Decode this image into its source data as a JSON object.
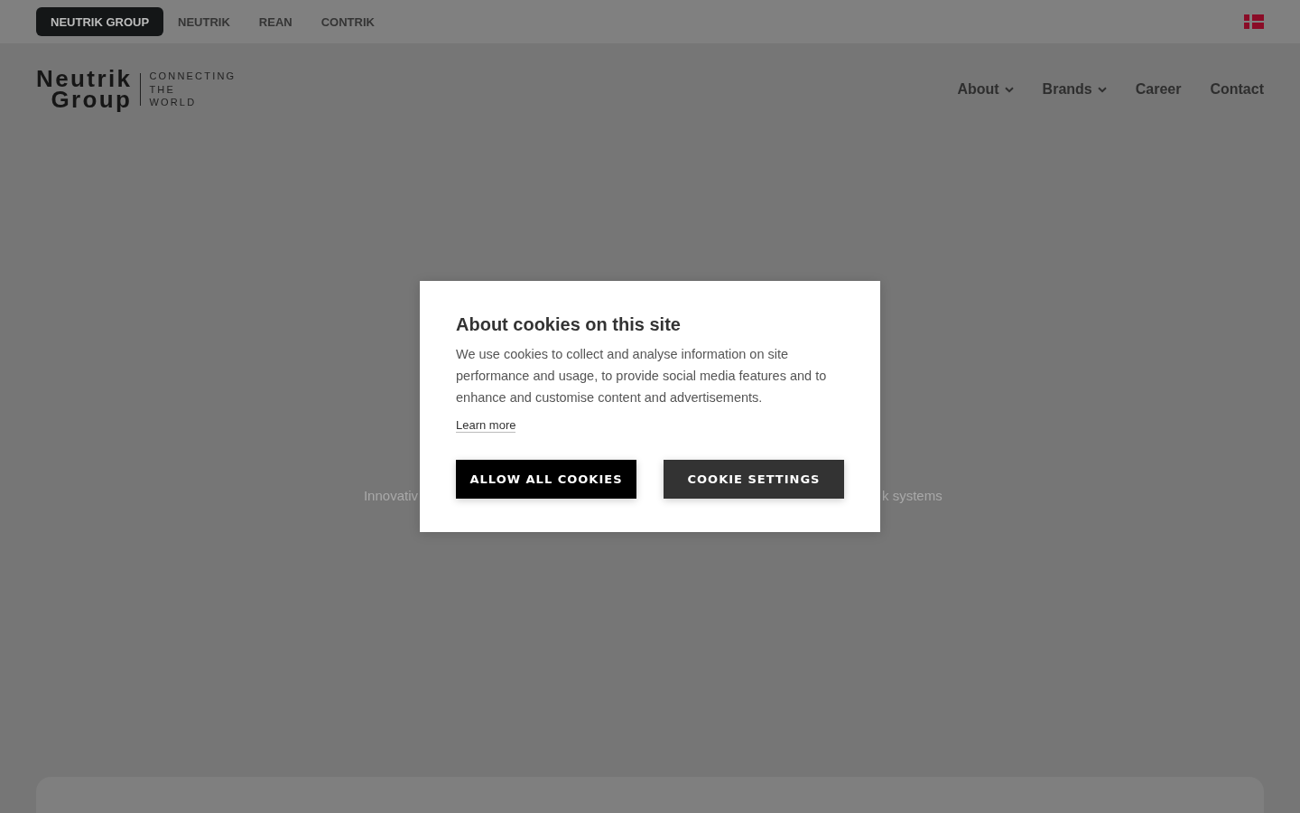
{
  "brand_tabs": [
    {
      "label": "NEUTRIK GROUP",
      "selected": true
    },
    {
      "label": "NEUTRIK",
      "selected": false
    },
    {
      "label": "REAN",
      "selected": false
    },
    {
      "label": "CONTRIK",
      "selected": false
    }
  ],
  "header": {
    "logo": {
      "wordmark_lines": [
        "Neutrik",
        "Group"
      ],
      "tagline_lines": [
        "CONNECTING",
        "THE",
        "WORLD"
      ]
    },
    "nav": [
      {
        "label": "About",
        "dropdown": true
      },
      {
        "label": "Brands",
        "dropdown": true
      },
      {
        "label": "Career",
        "dropdown": false
      },
      {
        "label": "Contact",
        "dropdown": false
      }
    ]
  },
  "hero": {
    "subtitle_fragments": [
      "Innovativ",
      "k systems"
    ]
  },
  "cookie_dialog": {
    "title": "About cookies on this site",
    "text": "We use cookies to collect and analyse information on site performance and usage, to provide social media features and to enhance and customise content and advertisements.",
    "link": "Learn more",
    "buttons": [
      {
        "label": "ALLOW ALL COOKIES",
        "kind": "primary"
      },
      {
        "label": "COOKIE SETTINGS",
        "kind": "secondary"
      }
    ]
  }
}
